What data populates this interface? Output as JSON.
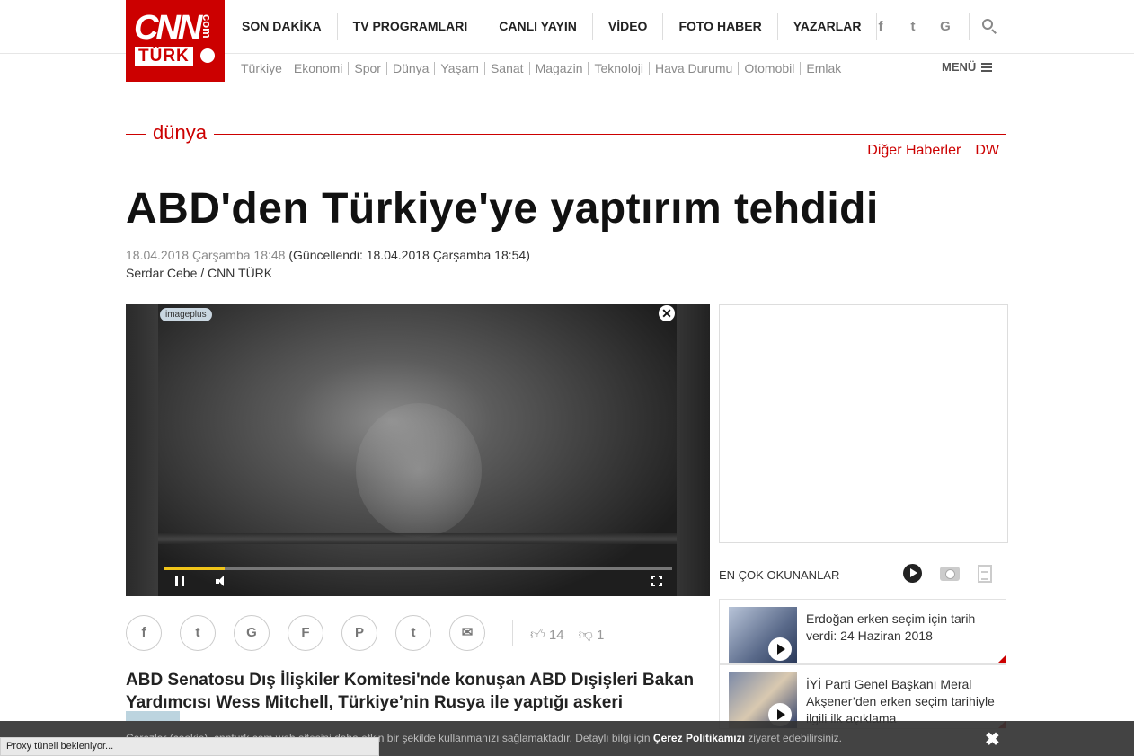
{
  "logo": {
    "cnn": "CNN",
    "com": "com",
    "turk": "TÜRK"
  },
  "mainnav": [
    "SON DAKİKA",
    "TV PROGRAMLARI",
    "CANLI YAYIN",
    "VİDEO",
    "FOTO HABER",
    "YAZARLAR"
  ],
  "social_top": [
    "f",
    "t",
    "G"
  ],
  "subnav": [
    "Türkiye",
    "Ekonomi",
    "Spor",
    "Dünya",
    "Yaşam",
    "Sanat",
    "Magazin",
    "Teknoloji",
    "Hava Durumu",
    "Otomobil",
    "Emlak"
  ],
  "menu_label": "MENÜ",
  "section": "dünya",
  "related": [
    "Diğer Haberler",
    "DW"
  ],
  "article": {
    "headline": "ABD'den Türkiye'ye yaptırım tehdidi",
    "date": "18.04.2018 Çarşamba 18:48",
    "updated": "(Güncellendi: 18.04.2018 Çarşamba 18:54)",
    "author": "Serdar Cebe / CNN TÜRK",
    "summary": "ABD Senatosu Dış İlişkiler Komitesi'nde konuşan ABD Dışişleri Bakan Yardımcısı Wess Mitchell,  Türkiye’nin Rusya ile yaptığı askeri"
  },
  "video": {
    "badge": "imageplus",
    "close": "✕",
    "progress": 0.12
  },
  "share": [
    "f",
    "t",
    "G",
    "F",
    "P",
    "t",
    "✉"
  ],
  "likes": {
    "up": "14",
    "down": "1"
  },
  "sidebar": {
    "most_read_label": "EN ÇOK OKUNANLAR",
    "items": [
      {
        "title": "Erdoğan erken seçim için tarih verdi: 24 Haziran 2018"
      },
      {
        "title": "İYİ Parti Genel Başkanı Meral Akşener’den erken seçim tarihiyle ilgili ilk açıklama"
      }
    ]
  },
  "cookie": {
    "text_before": "Çerezler (cookie), cnnturk.com web sitesini daha etkin bir şekilde kullanmanızı sağlamaktadır. Detaylı bilgi için ",
    "link": "Çerez Politikamızı",
    "text_after": " ziyaret edebilirsiniz.",
    "close": "✖"
  },
  "status_bar": "Proxy tüneli bekleniyor..."
}
